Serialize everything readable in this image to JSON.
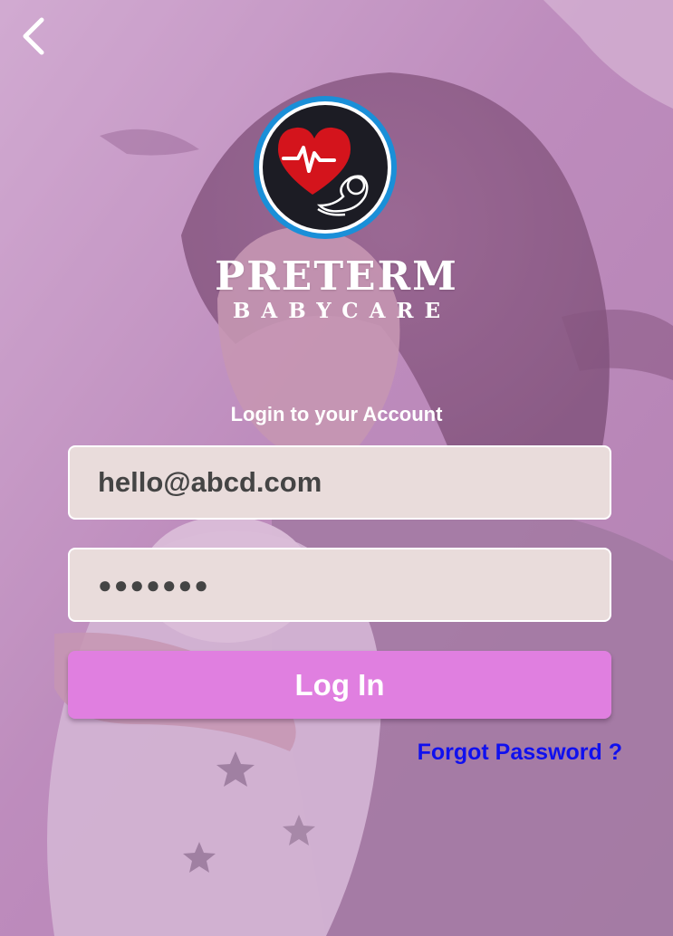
{
  "back_icon": "chevron-left-icon",
  "logo_icon": "heart-pulse-baby-icon",
  "brand": {
    "title": "PRETERM",
    "subtitle": "BABYCARE"
  },
  "login": {
    "heading": "Login to your Account",
    "email_value": "hello@abcd.com",
    "password_value": "●●●●●●●",
    "button_label": "Log In",
    "forgot_label": "Forgot Password ?"
  },
  "colors": {
    "overlay": "#c68ec6",
    "field_bg": "#e9dcdb",
    "button": "#e07fe0",
    "link": "#1010ee",
    "heart": "#d4141c",
    "badge_ring": "#1a8fd8",
    "badge_fill": "#1c1c24"
  }
}
